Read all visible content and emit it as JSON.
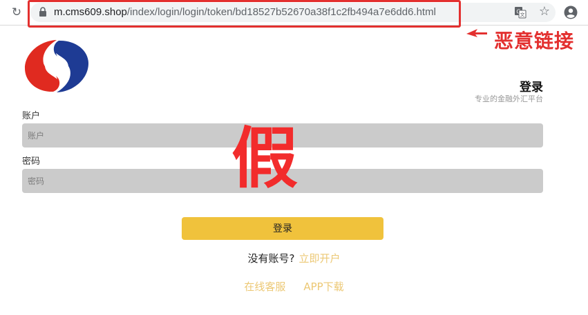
{
  "browser": {
    "url_host": "m.cms609.shop",
    "url_path": "/index/login/login/token/bd18527b52670a38f1c2fb494a7e6dd6.html",
    "icons": [
      "reload-icon",
      "lock-icon",
      "translate-icon",
      "star-icon",
      "profile-icon"
    ]
  },
  "annotation": {
    "label": "恶意链接",
    "color": "#e3302f"
  },
  "header": {
    "title": "登录",
    "subtitle": "专业的金融外汇平台"
  },
  "form": {
    "account_label": "账户",
    "account_placeholder": "账户",
    "password_label": "密码",
    "password_placeholder": "密码",
    "submit_label": "登录"
  },
  "watermark": {
    "text": "假"
  },
  "signup": {
    "prompt": "没有账号?",
    "link": "立即开户"
  },
  "footer": {
    "service": "在线客服",
    "app_download": "APP下载"
  },
  "colors": {
    "accent": "#f0c23c",
    "link": "#ecc874",
    "input_bg": "#cbcbcb",
    "warning": "#f22c2c"
  }
}
